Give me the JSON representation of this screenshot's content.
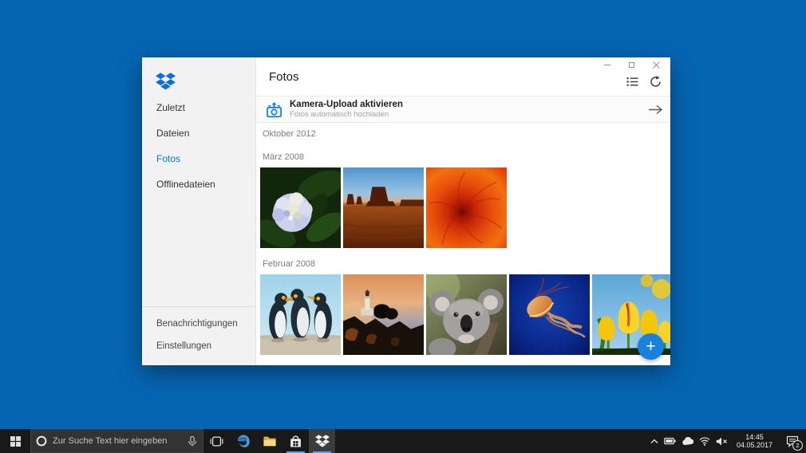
{
  "app": {
    "name": "Dropbox"
  },
  "window": {
    "header": {
      "title": "Fotos"
    },
    "caption_icons": [
      "minimize-icon",
      "maximize-icon",
      "close-icon"
    ],
    "toolbar_icons": [
      "multi-select-icon",
      "refresh-icon"
    ],
    "banner": {
      "title": "Kamera-Upload aktivieren",
      "subtitle": "Fotos automatisch hochladen",
      "icons": [
        "camera-upload-icon",
        "arrow-right-icon"
      ]
    },
    "sidebar": {
      "logo_icon": "dropbox-logo",
      "items": [
        {
          "label": "Zuletzt",
          "active": false
        },
        {
          "label": "Dateien",
          "active": false
        },
        {
          "label": "Fotos",
          "active": true
        },
        {
          "label": "Offlinedateien",
          "active": false
        }
      ],
      "bottom_items": [
        {
          "label": "Benachrichtigungen"
        },
        {
          "label": "Einstellungen"
        }
      ]
    },
    "sections": [
      {
        "label": "Oktober 2012",
        "photos": []
      },
      {
        "label": "März 2008",
        "photos": [
          {
            "id": "hydrangea",
            "desc": "white-blue hydrangea flower on dark leaves"
          },
          {
            "id": "monument-valley",
            "desc": "orange desert butte under blue sky"
          },
          {
            "id": "chrysanthemum",
            "desc": "orange chrysanthemum close-up"
          }
        ]
      },
      {
        "label": "Februar 2008",
        "photos": [
          {
            "id": "penguins",
            "desc": "three king penguins"
          },
          {
            "id": "lighthouse",
            "desc": "lighthouse on dark rocks at dusk"
          },
          {
            "id": "koala",
            "desc": "koala face"
          },
          {
            "id": "jellyfish",
            "desc": "orange jellyfish in deep blue water"
          },
          {
            "id": "tulips",
            "desc": "yellow tulips against blue sky"
          }
        ]
      }
    ],
    "fab": {
      "glyph": "+"
    }
  },
  "taskbar": {
    "start_icon": "windows-logo",
    "search": {
      "placeholder": "Zur Suche Text hier eingeben",
      "icons": [
        "cortana-ring-icon",
        "microphone-icon"
      ]
    },
    "apps": [
      {
        "id": "task-view",
        "running": false,
        "active": false
      },
      {
        "id": "edge",
        "running": false,
        "active": false
      },
      {
        "id": "file-explorer",
        "running": false,
        "active": false
      },
      {
        "id": "store",
        "running": true,
        "active": false
      },
      {
        "id": "dropbox",
        "running": true,
        "active": true
      }
    ],
    "tray": {
      "icons": [
        "chevron-up-icon",
        "battery-icon",
        "onedrive-cloud-icon",
        "wifi-icon",
        "volume-muted-icon"
      ],
      "time": "14:45",
      "date": "04.05.2017",
      "action_center_badge": "2"
    }
  },
  "colors": {
    "desktop": "#0665b2",
    "accent": "#0078d7",
    "dropbox_blue": "#0d6be3",
    "fab": "#1781dd",
    "taskbar": "#191919",
    "running_indicator": "#5ba2dc"
  }
}
